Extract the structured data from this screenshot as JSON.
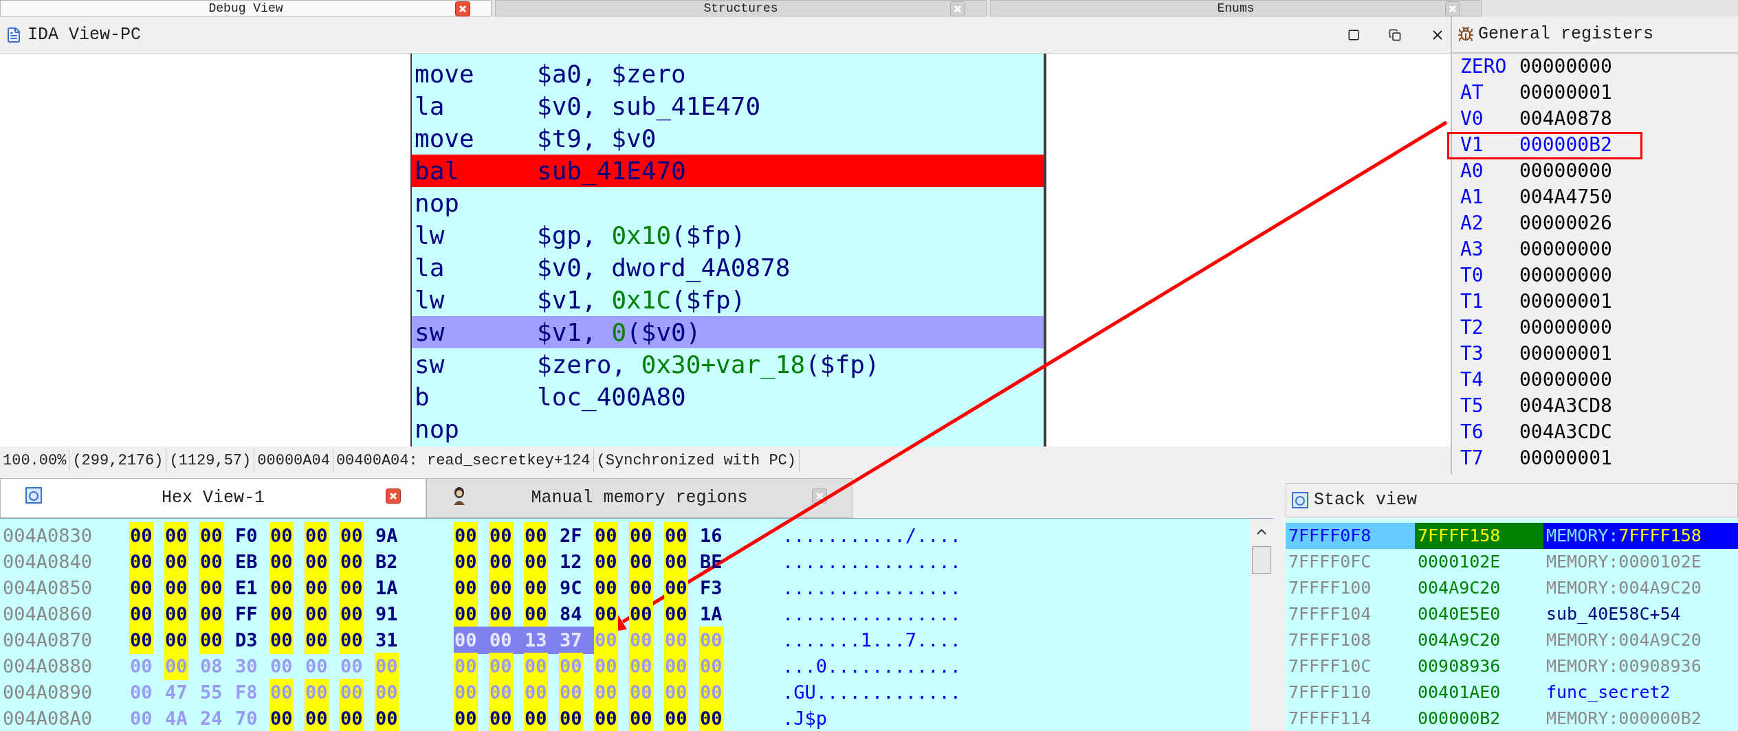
{
  "top_tabs": [
    {
      "label": "Debug View",
      "selected": true
    },
    {
      "label": "Structures",
      "selected": false
    },
    {
      "label": "Enums",
      "selected": false
    }
  ],
  "ida_view": {
    "title": "IDA View-PC",
    "lines": [
      {
        "mnemonic": "move",
        "operands": [
          {
            "text": "$a0, $zero",
            "kind": "reg"
          }
        ],
        "breakpoint": false,
        "current": false
      },
      {
        "mnemonic": "la",
        "operands": [
          {
            "text": "$v0, sub_41E470",
            "kind": "reg"
          }
        ],
        "breakpoint": false,
        "current": false
      },
      {
        "mnemonic": "move",
        "operands": [
          {
            "text": "$t9, $v0",
            "kind": "reg"
          }
        ],
        "breakpoint": false,
        "current": false
      },
      {
        "mnemonic": "bal",
        "operands": [
          {
            "text": "sub_41E470",
            "kind": "reg"
          }
        ],
        "breakpoint": true,
        "current": false
      },
      {
        "mnemonic": "nop",
        "breakpoint": false,
        "current": false
      },
      {
        "mnemonic": "lw",
        "operands": [
          {
            "text": "$gp, ",
            "kind": "reg"
          },
          {
            "text": "0x10",
            "kind": "number"
          },
          {
            "text": "($fp)",
            "kind": "reg"
          }
        ],
        "breakpoint": false,
        "current": false
      },
      {
        "mnemonic": "la",
        "operands": [
          {
            "text": "$v0, dword_4A0878",
            "kind": "reg"
          }
        ],
        "breakpoint": false,
        "current": false
      },
      {
        "mnemonic": "lw",
        "operands": [
          {
            "text": "$v1, ",
            "kind": "reg"
          },
          {
            "text": "0x1C",
            "kind": "number"
          },
          {
            "text": "($fp)",
            "kind": "reg"
          }
        ],
        "breakpoint": false,
        "current": false
      },
      {
        "mnemonic": "sw",
        "operands": [
          {
            "text": "$v1, ",
            "kind": "reg"
          },
          {
            "text": "0",
            "kind": "number"
          },
          {
            "text": "($v0)",
            "kind": "reg"
          }
        ],
        "breakpoint": false,
        "current": true
      },
      {
        "mnemonic": "sw",
        "operands": [
          {
            "text": "$zero, ",
            "kind": "reg"
          },
          {
            "text": "0x30+var_18",
            "kind": "number"
          },
          {
            "text": "($fp)",
            "kind": "reg"
          }
        ],
        "breakpoint": false,
        "current": false
      },
      {
        "mnemonic": "b",
        "operands": [
          {
            "text": "loc_400A80",
            "kind": "reg"
          }
        ],
        "breakpoint": false,
        "current": false
      },
      {
        "mnemonic": "nop",
        "breakpoint": false,
        "current": false
      }
    ]
  },
  "status_bar": [
    "100.00%",
    "(299,2176)",
    "(1129,57)",
    "00000A04",
    "00400A04: read_secretkey+124",
    "(Synchronized with PC)"
  ],
  "registers": {
    "title": "General registers",
    "rows": [
      {
        "name": "ZERO",
        "value": "00000000",
        "changed": false
      },
      {
        "name": "AT",
        "value": "00000001",
        "changed": false
      },
      {
        "name": "V0",
        "value": "004A0878",
        "changed": false
      },
      {
        "name": "V1",
        "value": "000000B2",
        "changed": true
      },
      {
        "name": "A0",
        "value": "00000000",
        "changed": false
      },
      {
        "name": "A1",
        "value": "004A4750",
        "changed": false
      },
      {
        "name": "A2",
        "value": "00000026",
        "changed": false
      },
      {
        "name": "A3",
        "value": "00000000",
        "changed": false
      },
      {
        "name": "T0",
        "value": "00000000",
        "changed": false
      },
      {
        "name": "T1",
        "value": "00000001",
        "changed": false
      },
      {
        "name": "T2",
        "value": "00000000",
        "changed": false
      },
      {
        "name": "T3",
        "value": "00000001",
        "changed": false
      },
      {
        "name": "T4",
        "value": "00000000",
        "changed": false
      },
      {
        "name": "T5",
        "value": "004A3CD8",
        "changed": false
      },
      {
        "name": "T6",
        "value": "004A3CDC",
        "changed": false
      },
      {
        "name": "T7",
        "value": "00000001",
        "changed": false
      }
    ]
  },
  "hex_view": {
    "tabs": [
      {
        "label": "Hex View-1",
        "selected": true
      },
      {
        "label": "Manual memory regions",
        "selected": false
      }
    ],
    "rows": [
      {
        "address": "004A0830",
        "bytes": [
          "00",
          "00",
          "00",
          "F0",
          "00",
          "00",
          "00",
          "9A",
          "00",
          "00",
          "00",
          "2F",
          "00",
          "00",
          "00",
          "16"
        ],
        "highlighted": [
          true,
          true,
          true,
          false,
          true,
          true,
          true,
          false,
          true,
          true,
          true,
          false,
          true,
          true,
          true,
          false
        ],
        "dimmed": [
          false,
          false,
          false,
          false,
          false,
          false,
          false,
          false,
          false,
          false,
          false,
          false,
          false,
          false,
          false,
          false
        ],
        "selected": [
          false,
          false,
          false,
          false,
          false,
          false,
          false,
          false,
          false,
          false,
          false,
          false,
          false,
          false,
          false,
          false
        ],
        "ascii": ".........../...."
      },
      {
        "address": "004A0840",
        "bytes": [
          "00",
          "00",
          "00",
          "EB",
          "00",
          "00",
          "00",
          "B2",
          "00",
          "00",
          "00",
          "12",
          "00",
          "00",
          "00",
          "BE"
        ],
        "highlighted": [
          true,
          true,
          true,
          false,
          true,
          true,
          true,
          false,
          true,
          true,
          true,
          false,
          true,
          true,
          true,
          false
        ],
        "dimmed": [
          false,
          false,
          false,
          false,
          false,
          false,
          false,
          false,
          false,
          false,
          false,
          false,
          false,
          false,
          false,
          false
        ],
        "selected": [
          false,
          false,
          false,
          false,
          false,
          false,
          false,
          false,
          false,
          false,
          false,
          false,
          false,
          false,
          false,
          false
        ],
        "ascii": "................"
      },
      {
        "address": "004A0850",
        "bytes": [
          "00",
          "00",
          "00",
          "E1",
          "00",
          "00",
          "00",
          "1A",
          "00",
          "00",
          "00",
          "9C",
          "00",
          "00",
          "00",
          "F3"
        ],
        "highlighted": [
          true,
          true,
          true,
          false,
          true,
          true,
          true,
          false,
          true,
          true,
          true,
          false,
          true,
          true,
          true,
          false
        ],
        "dimmed": [
          false,
          false,
          false,
          false,
          false,
          false,
          false,
          false,
          false,
          false,
          false,
          false,
          false,
          false,
          false,
          false
        ],
        "selected": [
          false,
          false,
          false,
          false,
          false,
          false,
          false,
          false,
          false,
          false,
          false,
          false,
          false,
          false,
          false,
          false
        ],
        "ascii": "................"
      },
      {
        "address": "004A0860",
        "bytes": [
          "00",
          "00",
          "00",
          "FF",
          "00",
          "00",
          "00",
          "91",
          "00",
          "00",
          "00",
          "84",
          "00",
          "00",
          "00",
          "1A"
        ],
        "highlighted": [
          true,
          true,
          true,
          false,
          true,
          true,
          true,
          false,
          true,
          true,
          true,
          false,
          true,
          true,
          true,
          false
        ],
        "dimmed": [
          false,
          false,
          false,
          false,
          false,
          false,
          false,
          false,
          false,
          false,
          false,
          false,
          false,
          false,
          false,
          false
        ],
        "selected": [
          false,
          false,
          false,
          false,
          false,
          false,
          false,
          false,
          false,
          false,
          false,
          false,
          false,
          false,
          false,
          false
        ],
        "ascii": "................"
      },
      {
        "address": "004A0870",
        "bytes": [
          "00",
          "00",
          "00",
          "D3",
          "00",
          "00",
          "00",
          "31",
          "00",
          "00",
          "13",
          "37",
          "00",
          "00",
          "00",
          "00"
        ],
        "highlighted": [
          true,
          true,
          true,
          false,
          true,
          true,
          true,
          false,
          false,
          false,
          false,
          false,
          true,
          true,
          true,
          true
        ],
        "dimmed": [
          false,
          false,
          false,
          false,
          false,
          false,
          false,
          false,
          false,
          false,
          false,
          false,
          true,
          true,
          true,
          true
        ],
        "selected": [
          false,
          false,
          false,
          false,
          false,
          false,
          false,
          false,
          true,
          true,
          true,
          true,
          false,
          false,
          false,
          false
        ],
        "ascii": ".......1...7...."
      },
      {
        "address": "004A0880",
        "bytes": [
          "00",
          "00",
          "08",
          "30",
          "00",
          "00",
          "00",
          "00",
          "00",
          "00",
          "00",
          "00",
          "00",
          "00",
          "00",
          "00"
        ],
        "highlighted": [
          false,
          true,
          false,
          false,
          false,
          false,
          false,
          true,
          true,
          true,
          true,
          true,
          true,
          true,
          true,
          true
        ],
        "dimmed": [
          true,
          true,
          true,
          true,
          true,
          true,
          true,
          true,
          true,
          true,
          true,
          true,
          true,
          true,
          true,
          true
        ],
        "selected": [
          false,
          false,
          false,
          false,
          false,
          false,
          false,
          false,
          false,
          false,
          false,
          false,
          false,
          false,
          false,
          false
        ],
        "ascii": "...0............"
      },
      {
        "address": "004A0890",
        "bytes": [
          "00",
          "47",
          "55",
          "F8",
          "00",
          "00",
          "00",
          "00",
          "00",
          "00",
          "00",
          "00",
          "00",
          "00",
          "00",
          "00"
        ],
        "highlighted": [
          false,
          false,
          false,
          false,
          true,
          true,
          true,
          true,
          true,
          true,
          true,
          true,
          true,
          true,
          true,
          true
        ],
        "dimmed": [
          true,
          true,
          true,
          true,
          true,
          true,
          true,
          true,
          true,
          true,
          true,
          true,
          true,
          true,
          true,
          true
        ],
        "selected": [
          false,
          false,
          false,
          false,
          false,
          false,
          false,
          false,
          false,
          false,
          false,
          false,
          false,
          false,
          false,
          false
        ],
        "ascii": ".GU............."
      },
      {
        "address": "004A08A0",
        "bytes": [
          "00",
          "4A",
          "24",
          "70",
          "00",
          "00",
          "00",
          "00",
          "00",
          "00",
          "00",
          "00",
          "00",
          "00",
          "00",
          "00"
        ],
        "highlighted": [
          false,
          false,
          false,
          false,
          true,
          true,
          true,
          true,
          true,
          true,
          true,
          true,
          true,
          true,
          true,
          true
        ],
        "dimmed": [
          true,
          true,
          true,
          true,
          false,
          false,
          false,
          false,
          false,
          false,
          false,
          false,
          false,
          false,
          false,
          false
        ],
        "selected": [
          false,
          false,
          false,
          false,
          false,
          false,
          false,
          false,
          false,
          false,
          false,
          false,
          false,
          false,
          false,
          false
        ],
        "ascii": ".J$p"
      }
    ]
  },
  "stack_view": {
    "title": "Stack view",
    "rows": [
      {
        "address": "7FFFF0F8",
        "value": "7FFFF158",
        "kind": "memory",
        "comment": "MEMORY:",
        "target": "7FFFF158",
        "selected": true
      },
      {
        "address": "7FFFF0FC",
        "value": "0000102E",
        "kind": "memory",
        "comment": "MEMORY:",
        "target": "0000102E",
        "selected": false
      },
      {
        "address": "7FFFF100",
        "value": "004A9C20",
        "kind": "memory",
        "comment": "MEMORY:",
        "target": "004A9C20",
        "selected": false
      },
      {
        "address": "7FFFF104",
        "value": "0040E5E0",
        "kind": "code",
        "comment": "sub_40E58C+54",
        "selected": false
      },
      {
        "address": "7FFFF108",
        "value": "004A9C20",
        "kind": "memory",
        "comment": "MEMORY:",
        "target": "004A9C20",
        "selected": false
      },
      {
        "address": "7FFFF10C",
        "value": "00908936",
        "kind": "memory",
        "comment": "MEMORY:",
        "target": "00908936",
        "selected": false
      },
      {
        "address": "7FFFF110",
        "value": "00401AE0",
        "kind": "function",
        "comment": "func_secret2",
        "selected": false
      },
      {
        "address": "7FFFF114",
        "value": "000000B2",
        "kind": "memory",
        "comment": "MEMORY:",
        "target": "000000B2",
        "selected": false
      }
    ]
  }
}
